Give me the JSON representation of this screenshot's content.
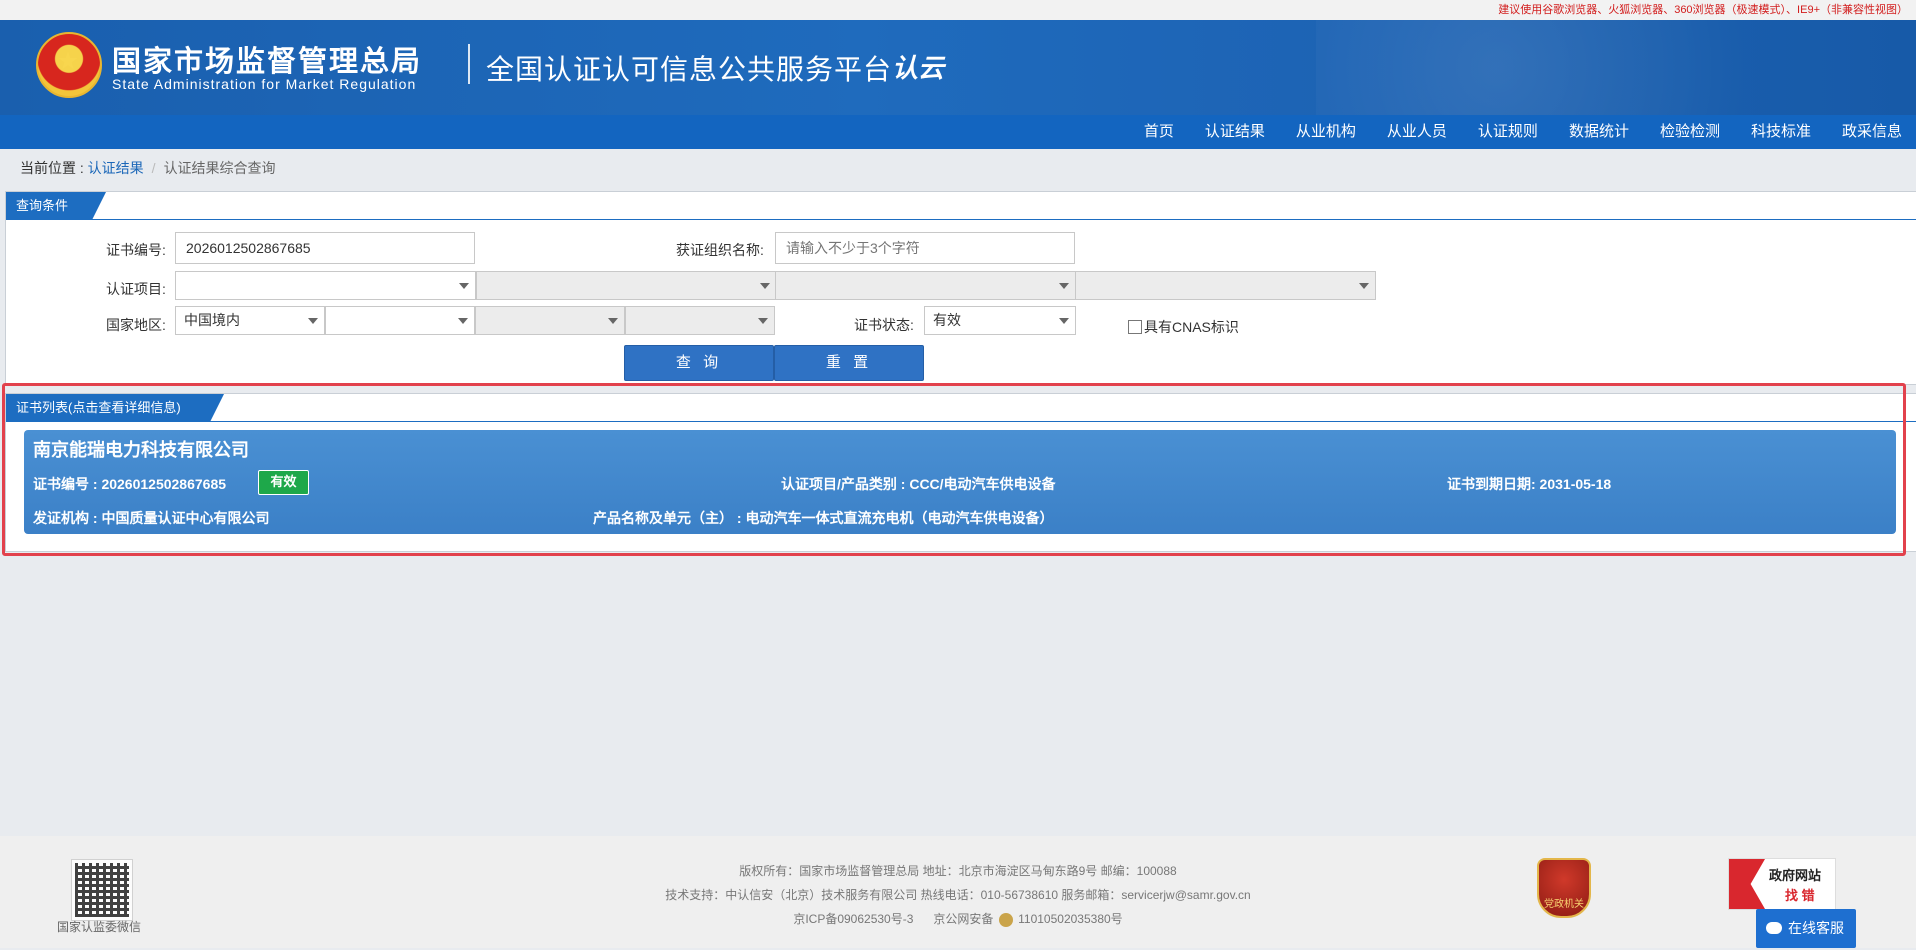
{
  "browser_note": "建议使用谷歌浏览器、火狐浏览器、360浏览器（极速模式）、IE9+（非兼容性视图）",
  "header": {
    "org_cn": "国家市场监督管理总局",
    "org_en": "State Administration  for  Market Regulation",
    "platform": "全国认证认可信息公共服务平台",
    "cloud_logo": "认云"
  },
  "nav": [
    "首页",
    "认证结果",
    "从业机构",
    "从业人员",
    "认证规则",
    "数据统计",
    "检验检测",
    "科技标准",
    "政采信息"
  ],
  "breadcrumb": {
    "label": "当前位置 : ",
    "link": "认证结果",
    "sep": "/",
    "current": "认证结果综合查询"
  },
  "query": {
    "tab": "查询条件",
    "cert_no_label": "证书编号:",
    "cert_no_value": "2026012502867685",
    "org_name_label": "获证组织名称:",
    "org_name_placeholder": "请输入不少于3个字符",
    "project_label": "认证项目:",
    "region_label": "国家地区:",
    "region_value": "中国境内",
    "status_label": "证书状态:",
    "status_value": "有效",
    "cnas_label": "具有CNAS标识",
    "search_btn": "查 询",
    "reset_btn": "重 置"
  },
  "results": {
    "tab": "证书列表(点击查看详细信息)",
    "items": [
      {
        "company": "南京能瑞电力科技有限公司",
        "cert_no": "证书编号 : 2026012502867685",
        "status": "有效",
        "project": "认证项目/产品类别 : CCC/电动汽车供电设备",
        "expiry": "证书到期日期: 2031-05-18",
        "issuer": "发证机构 : 中国质量认证中心有限公司",
        "product": "产品名称及单元（主） : 电动汽车一体式直流充电机（电动汽车供电设备）"
      }
    ]
  },
  "footer": {
    "qr_label": "国家认监委微信",
    "line1": "版权所有：国家市场监督管理总局    地址：北京市海淀区马甸东路9号    邮编：100088",
    "line2": "技术支持：中认信安（北京）技术服务有限公司    热线电话：010-56738610    服务邮箱：servicerjw@samr.gov.cn",
    "icp": "京ICP备09062530号-3",
    "police": "京公网安备",
    "police_no": "11010502035380号",
    "seal_label": "党政机关",
    "gov_err_1": "政府网站",
    "gov_err_2": "找 错",
    "online_service": "在线客服"
  },
  "colors": {
    "brand_blue": "#1d6dc1",
    "nav_blue": "#1365c0",
    "valid_green": "#1ea84a",
    "highlight_red": "#e2414c"
  }
}
